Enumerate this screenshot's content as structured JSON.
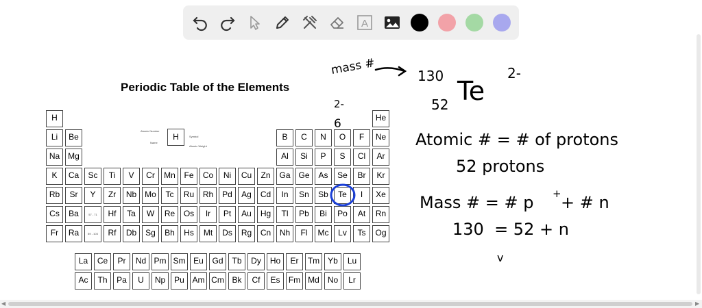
{
  "toolbar": {
    "tools": [
      {
        "name": "undo-icon"
      },
      {
        "name": "redo-icon"
      },
      {
        "name": "select-pointer-icon"
      },
      {
        "name": "pen-icon"
      },
      {
        "name": "tools-icon"
      },
      {
        "name": "eraser-icon"
      },
      {
        "name": "text-icon",
        "glyph": "A"
      },
      {
        "name": "image-icon"
      }
    ],
    "colors": [
      "#000000",
      "#f2a2a8",
      "#a4d9a4",
      "#a8a8ee"
    ]
  },
  "periodic_table": {
    "title": "Periodic Table of the Elements",
    "legend": {
      "symbol": "H",
      "atomic_number_label": "Atomic Number",
      "name_label": "Name",
      "symbol_label": "Symbol",
      "weight_label": "Atomic Weight"
    },
    "lanthanide_placeholder": "57 - 71",
    "actinide_placeholder": "89 - 103",
    "rows": [
      [
        "H",
        null,
        null,
        null,
        null,
        null,
        null,
        null,
        null,
        null,
        null,
        null,
        null,
        null,
        null,
        null,
        null,
        "He"
      ],
      [
        "Li",
        "Be",
        null,
        null,
        null,
        null,
        null,
        null,
        null,
        null,
        null,
        null,
        "B",
        "C",
        "N",
        "O",
        "F",
        "Ne"
      ],
      [
        "Na",
        "Mg",
        null,
        null,
        null,
        null,
        null,
        null,
        null,
        null,
        null,
        null,
        "Al",
        "Si",
        "P",
        "S",
        "Cl",
        "Ar"
      ],
      [
        "K",
        "Ca",
        "Sc",
        "Ti",
        "V",
        "Cr",
        "Mn",
        "Fe",
        "Co",
        "Ni",
        "Cu",
        "Zn",
        "Ga",
        "Ge",
        "As",
        "Se",
        "Br",
        "Kr"
      ],
      [
        "Rb",
        "Sr",
        "Y",
        "Zr",
        "Nb",
        "Mo",
        "Tc",
        "Ru",
        "Rh",
        "Pd",
        "Ag",
        "Cd",
        "In",
        "Sn",
        "Sb",
        "Te",
        "I",
        "Xe"
      ],
      [
        "Cs",
        "Ba",
        "*",
        "Hf",
        "Ta",
        "W",
        "Re",
        "Os",
        "Ir",
        "Pt",
        "Au",
        "Hg",
        "Tl",
        "Pb",
        "Bi",
        "Po",
        "At",
        "Rn"
      ],
      [
        "Fr",
        "Ra",
        "**",
        "Rf",
        "Db",
        "Sg",
        "Bh",
        "Hs",
        "Mt",
        "Ds",
        "Rg",
        "Cn",
        "Nh",
        "Fl",
        "Mc",
        "Lv",
        "Ts",
        "Og"
      ]
    ],
    "lanthanides": [
      "La",
      "Ce",
      "Pr",
      "Nd",
      "Pm",
      "Sm",
      "Eu",
      "Gd",
      "Tb",
      "Dy",
      "Ho",
      "Er",
      "Tm",
      "Yb",
      "Lu"
    ],
    "actinides": [
      "Ac",
      "Th",
      "Pa",
      "U",
      "Np",
      "Pu",
      "Am",
      "Cm",
      "Bk",
      "Cf",
      "Es",
      "Fm",
      "Md",
      "No",
      "Lr"
    ],
    "highlighted": "Te"
  },
  "annotations": {
    "margin_charge": "2-",
    "margin_group": "6",
    "mass_label": "mass #",
    "isotope": {
      "mass_number": "130",
      "atomic_number": "52",
      "symbol": "Te",
      "charge": "2-"
    },
    "line1": "Atomic # = # of protons",
    "line2": "52 protons",
    "line3_left": "Mass # = # p",
    "line3_sup": "+",
    "line3_right": " + # n",
    "line4": "130  = 52 + n",
    "line5": "v",
    "ink_color": "#000000",
    "highlight_color": "#1a3fd6"
  }
}
